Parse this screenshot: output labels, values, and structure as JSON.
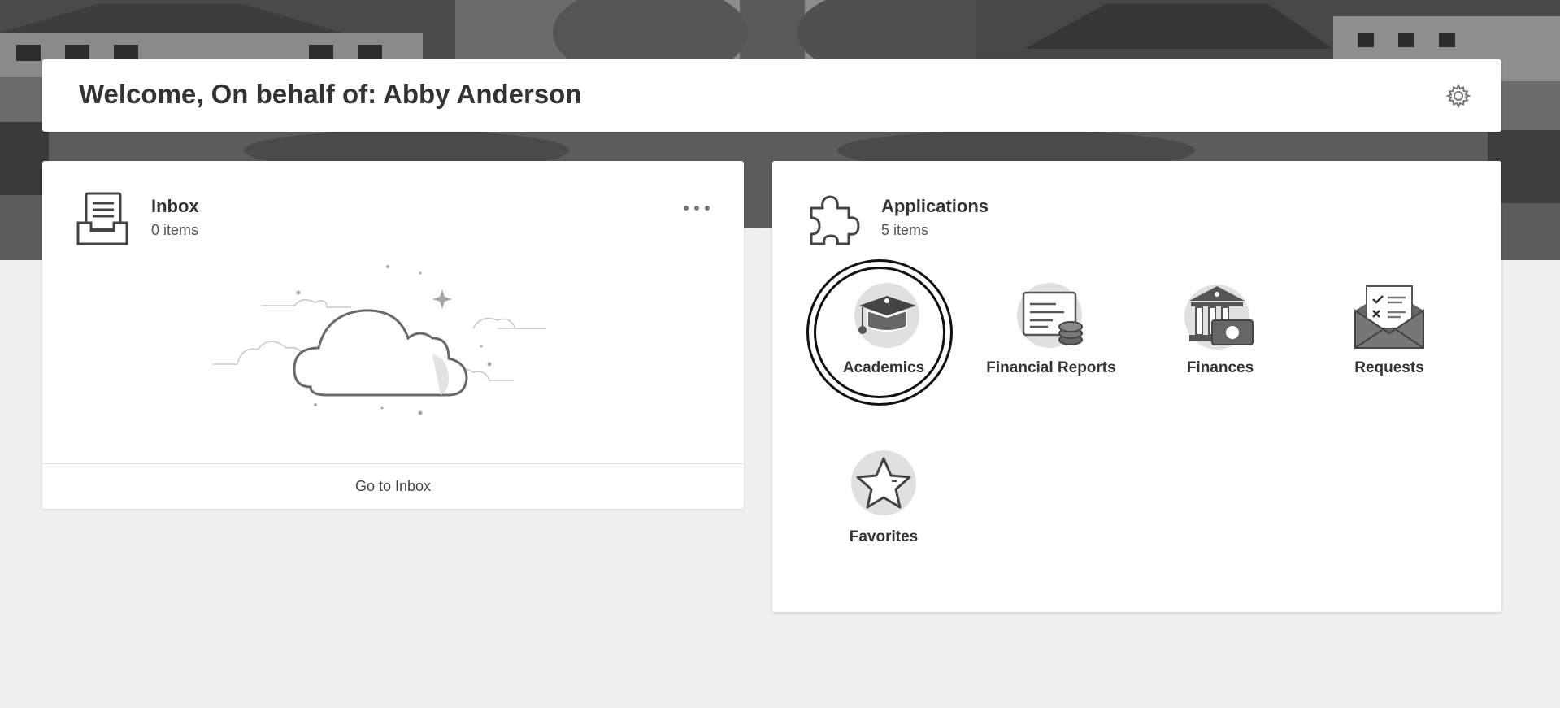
{
  "header": {
    "welcome_title": "Welcome, On behalf of: Abby Anderson",
    "settings_icon": "gear-icon"
  },
  "inbox": {
    "title": "Inbox",
    "count_text": "0 items",
    "footer_link": "Go to Inbox",
    "icon": "inbox-tray-icon",
    "menu_icon": "more-options-icon",
    "empty_state_icon": "cloud-illustration"
  },
  "applications": {
    "title": "Applications",
    "count_text": "5 items",
    "icon": "puzzle-piece-icon",
    "items": [
      {
        "label": "Academics",
        "icon": "graduation-cap-icon",
        "focused": true
      },
      {
        "label": "Financial Reports",
        "icon": "report-coins-icon"
      },
      {
        "label": "Finances",
        "icon": "bank-money-icon"
      },
      {
        "label": "Requests",
        "icon": "envelope-checklist-icon"
      },
      {
        "label": "Favorites",
        "icon": "star-icon"
      }
    ]
  },
  "colors": {
    "background": "#f0f0f0",
    "card": "#ffffff",
    "text": "#333333",
    "icon_circle": "#e0e0e0",
    "icon_dark": "#555555"
  }
}
